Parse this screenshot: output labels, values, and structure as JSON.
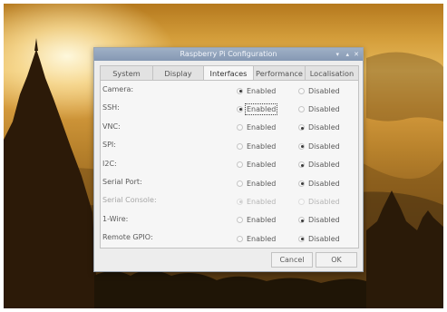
{
  "window": {
    "title": "Raspberry Pi Configuration",
    "controls": {
      "minimize": "▾",
      "maximize": "▴",
      "close": "✕"
    }
  },
  "tabs": [
    {
      "label": "System",
      "active": false
    },
    {
      "label": "Display",
      "active": false
    },
    {
      "label": "Interfaces",
      "active": true
    },
    {
      "label": "Performance",
      "active": false
    },
    {
      "label": "Localisation",
      "active": false
    }
  ],
  "options": {
    "enabled_label": "Enabled",
    "disabled_label": "Disabled"
  },
  "interfaces": [
    {
      "label": "Camera:",
      "selected": "enabled",
      "greyed": false
    },
    {
      "label": "SSH:",
      "selected": "enabled",
      "greyed": false,
      "focused": true
    },
    {
      "label": "VNC:",
      "selected": "disabled",
      "greyed": false
    },
    {
      "label": "SPI:",
      "selected": "disabled",
      "greyed": false
    },
    {
      "label": "I2C:",
      "selected": "disabled",
      "greyed": false
    },
    {
      "label": "Serial Port:",
      "selected": "disabled",
      "greyed": false
    },
    {
      "label": "Serial Console:",
      "selected": "enabled",
      "greyed": true
    },
    {
      "label": "1-Wire:",
      "selected": "disabled",
      "greyed": false
    },
    {
      "label": "Remote GPIO:",
      "selected": "disabled",
      "greyed": false
    }
  ],
  "buttons": {
    "cancel": "Cancel",
    "ok": "OK"
  },
  "colors": {
    "titlebar": "#8fa1bc",
    "dialog_bg": "#ededed",
    "panel_bg": "#f6f6f6"
  }
}
